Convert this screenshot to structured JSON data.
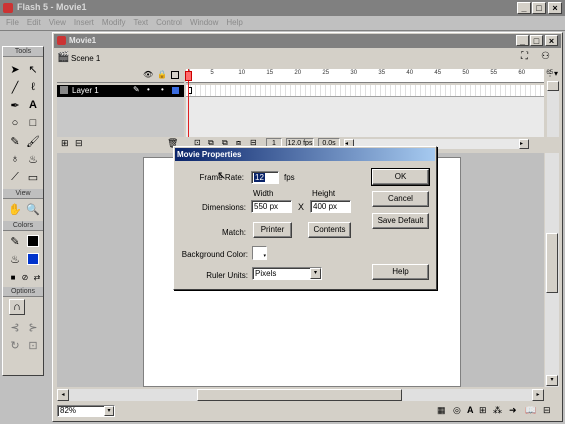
{
  "app": {
    "title": "Flash 5 - Movie1",
    "menu": [
      "File",
      "Edit",
      "View",
      "Insert",
      "Modify",
      "Text",
      "Control",
      "Window",
      "Help"
    ]
  },
  "doc": {
    "title": "Movie1",
    "scene": "Scene 1",
    "zoom": "82%"
  },
  "tools": {
    "header": "Tools",
    "view_header": "View",
    "colors_header": "Colors",
    "options_header": "Options",
    "text_tool": "A"
  },
  "timeline": {
    "layer": "Layer 1",
    "ticks": [
      "1",
      "5",
      "10",
      "15",
      "20",
      "25",
      "30",
      "35",
      "40",
      "45",
      "50",
      "55",
      "60",
      "65"
    ],
    "current_frame": "1",
    "fps": "12.0 fps",
    "time": "0.0s"
  },
  "dialog": {
    "title": "Movie Properties",
    "frame_rate_label": "Frame Rate:",
    "frame_rate": "12",
    "fps_unit": "fps",
    "width_label": "Width",
    "height_label": "Height",
    "dimensions_label": "Dimensions:",
    "width": "550 px",
    "times": "X",
    "height": "400 px",
    "match_label": "Match:",
    "printer_button": "Printer",
    "contents_button": "Contents",
    "bg_label": "Background Color:",
    "ruler_label": "Ruler Units:",
    "ruler_value": "Pixels",
    "ok": "OK",
    "cancel": "Cancel",
    "save_default": "Save Default",
    "help": "Help"
  }
}
